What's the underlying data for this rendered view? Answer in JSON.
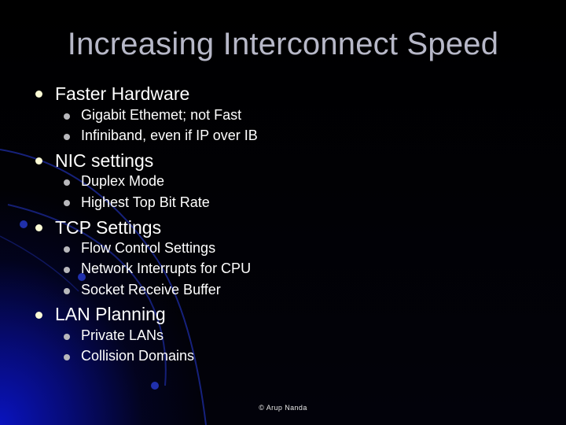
{
  "slide": {
    "title": "Increasing Interconnect Speed",
    "bullets": [
      {
        "label": "Faster Hardware",
        "children": [
          "Gigabit Ethemet; not Fast",
          "Infiniband, even if IP over IB"
        ]
      },
      {
        "label": "NIC settings",
        "children": [
          "Duplex Mode",
          "Highest Top Bit Rate"
        ]
      },
      {
        "label": "TCP Settings",
        "children": [
          "Flow Control Settings",
          "Network Interrupts for CPU",
          "Socket Receive Buffer"
        ]
      },
      {
        "label": "LAN Planning",
        "children": [
          "Private LANs",
          "Collision Domains"
        ]
      }
    ],
    "footer": "© Arup Nanda"
  },
  "colors": {
    "background": "#000000",
    "title_text": "#b7b8c8",
    "body_text": "#ffffff",
    "level1_bullet": "#fbfbd5",
    "level2_bullet": "#b8b8bc",
    "accent_glow": "#0a14c8"
  }
}
